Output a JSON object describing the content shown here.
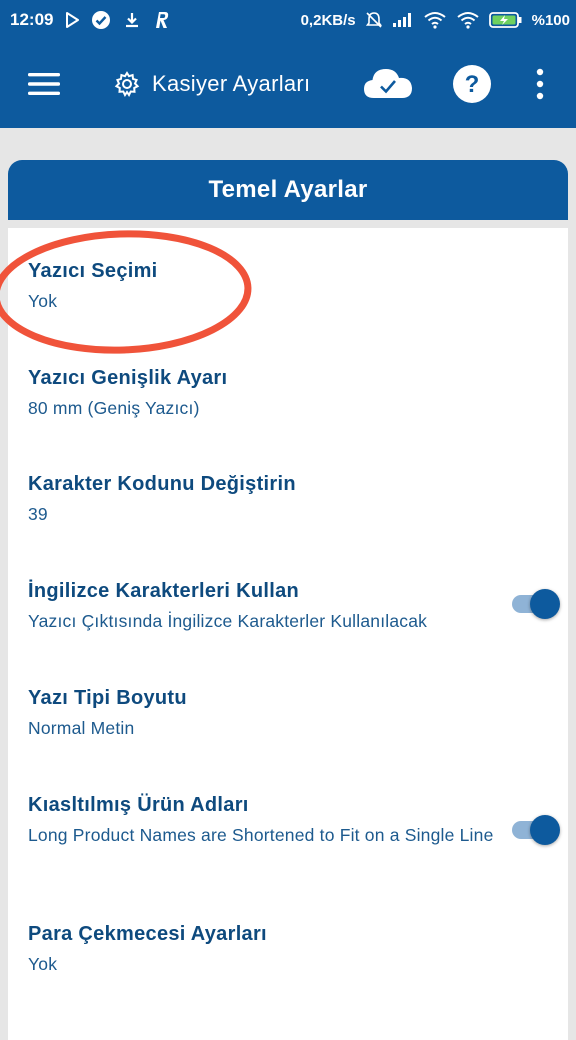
{
  "status_bar": {
    "time": "12:09",
    "net_speed": "0,2KB/s",
    "battery": "%100",
    "icons": [
      "play-store-icon",
      "check-circle-icon",
      "download-icon",
      "r-app-icon",
      "alarm-off-icon",
      "signal-icon",
      "wifi-icon",
      "wifi-secondary-icon",
      "battery-charging-icon"
    ]
  },
  "app_bar": {
    "title": "Kasiyer Ayarları",
    "icons": [
      "menu-icon",
      "gear-icon",
      "cloud-check-icon",
      "help-icon",
      "more-vertical-icon"
    ]
  },
  "card": {
    "header": "Temel Ayarlar"
  },
  "settings": [
    {
      "title": "Yazıcı Seçimi",
      "subtitle": "Yok",
      "toggle": null
    },
    {
      "title": "Yazıcı Genişlik Ayarı",
      "subtitle": "80 mm (Geniş Yazıcı)",
      "toggle": null
    },
    {
      "title": "Karakter Kodunu Değiştirin",
      "subtitle": "39",
      "toggle": null
    },
    {
      "title": "İngilizce Karakterleri Kullan",
      "subtitle": "Yazıcı Çıktısında İngilizce Karakterler Kullanılacak",
      "toggle": true
    },
    {
      "title": "Yazı Tipi Boyutu",
      "subtitle": "Normal Metin",
      "toggle": null
    },
    {
      "title": "Kıasltılmış Ürün Adları",
      "subtitle": "Long Product Names are Shortened to Fit on a Single Line",
      "toggle": true
    },
    {
      "title": "Para Çekmecesi Ayarları",
      "subtitle": "Yok",
      "toggle": null
    }
  ],
  "colors": {
    "primary": "#0d5a9e",
    "title_text": "#0e4a7e",
    "annotation": "#f0533a",
    "toggle_track": "#8fb3d6"
  }
}
